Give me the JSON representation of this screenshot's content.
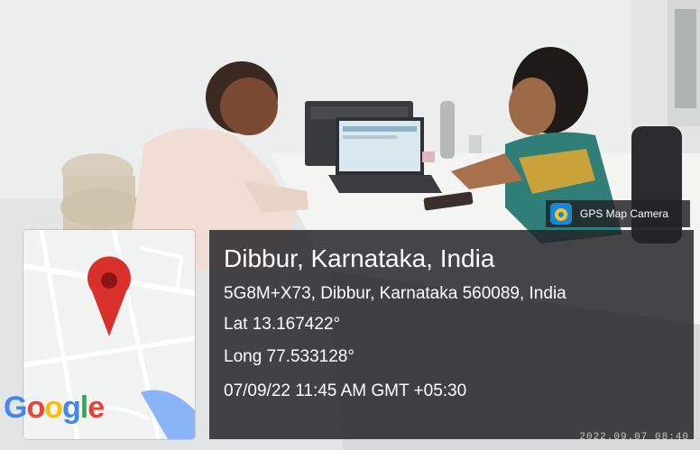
{
  "gps_overlay": {
    "title": "Dibbur, Karnataka, India",
    "address": "5G8M+X73, Dibbur, Karnataka 560089, India",
    "latitude": "Lat 13.167422°",
    "longitude": "Long 77.533128°",
    "datetime": "07/09/22 11:45 AM GMT +05:30"
  },
  "app_badge": {
    "label": "GPS Map Camera",
    "icon": "gps-map-camera-icon"
  },
  "map_thumbnail": {
    "logo_text": "Google",
    "logo_letters": [
      {
        "char": "G",
        "color": "#4285F4"
      },
      {
        "char": "o",
        "color": "#EA4335"
      },
      {
        "char": "o",
        "color": "#FBBC05"
      },
      {
        "char": "g",
        "color": "#4285F4"
      },
      {
        "char": "l",
        "color": "#34A853"
      },
      {
        "char": "e",
        "color": "#EA4335"
      }
    ],
    "pin_icon": "map-pin-icon",
    "pin_color": "#d9302c"
  },
  "photo_timestamp": "2022.09.07 08:40"
}
